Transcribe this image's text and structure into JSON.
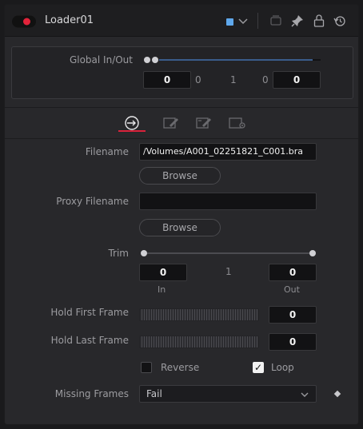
{
  "header": {
    "title": "Loader01",
    "node_color": "#5fa8ec",
    "enabled_color": "#e2233a",
    "icons": [
      "color-dropdown-chevron-icon",
      "version-icon",
      "pin-icon",
      "lock-icon",
      "reset-icon"
    ]
  },
  "global_inout": {
    "label": "Global In/Out",
    "start_value": "0",
    "range_left": "0",
    "range_mid": "1",
    "range_right": "0",
    "end_value": "0"
  },
  "tabs": [
    {
      "name": "tab-file-icon",
      "active": true
    },
    {
      "name": "tab-format-icon",
      "active": false
    },
    {
      "name": "tab-import-icon",
      "active": false
    },
    {
      "name": "tab-settings-icon",
      "active": false
    }
  ],
  "filename": {
    "label": "Filename",
    "value": "/Volumes/A001_02251821_C001.bra",
    "browse_label": "Browse"
  },
  "proxy": {
    "label": "Proxy Filename",
    "value": "",
    "browse_label": "Browse"
  },
  "trim": {
    "label": "Trim",
    "in_value": "0",
    "mid_value": "1",
    "out_value": "0",
    "in_caption": "In",
    "out_caption": "Out"
  },
  "hold_first": {
    "label": "Hold First Frame",
    "value": "0"
  },
  "hold_last": {
    "label": "Hold Last Frame",
    "value": "0"
  },
  "reverse": {
    "label": "Reverse",
    "checked": false
  },
  "loop": {
    "label": "Loop",
    "checked": true,
    "check_glyph": "✓"
  },
  "missing_frames": {
    "label": "Missing Frames",
    "selected": "Fail"
  }
}
